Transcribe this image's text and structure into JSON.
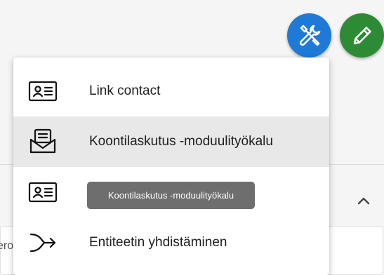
{
  "background": {
    "card_text": "ero"
  },
  "fabs": {
    "tools": {
      "icon": "tools-icon",
      "color": "#1e7ad6"
    },
    "edit": {
      "icon": "pencil-icon",
      "color": "#2e8b35"
    }
  },
  "menu": {
    "items": [
      {
        "label": "Link contact",
        "icon": "contact-card-icon"
      },
      {
        "label": "Koontilaskutus -moduulityökalu",
        "icon": "inbox-envelope-icon",
        "highlighted": true
      },
      {
        "label": "",
        "icon": "contact-card-icon"
      },
      {
        "label": "Entiteetin yhdistäminen",
        "icon": "merge-arrow-icon"
      }
    ]
  },
  "tooltip": {
    "text": "Koontilaskutus -moduulityökalu"
  }
}
